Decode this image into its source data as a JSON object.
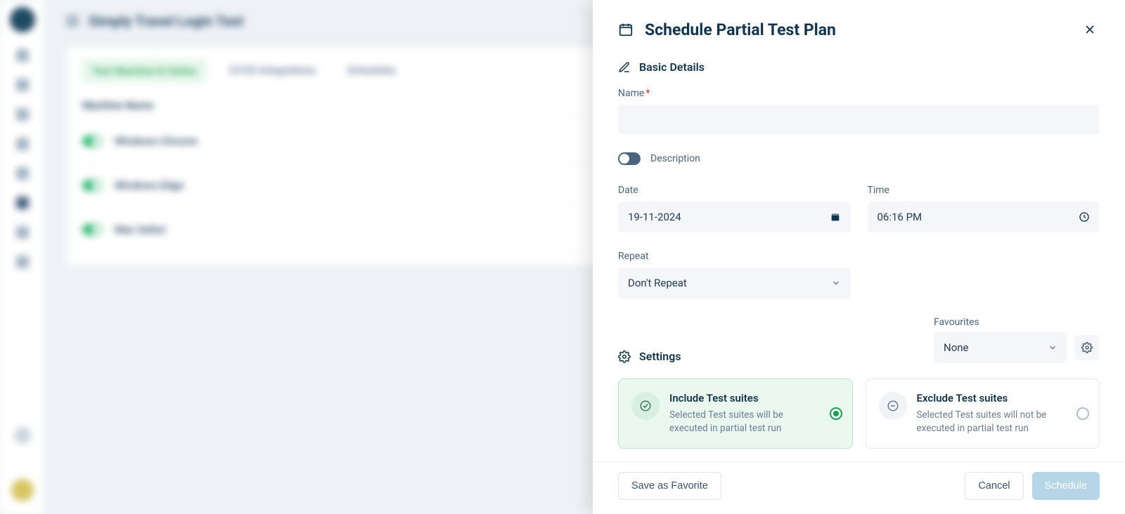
{
  "page_title": "Simply Travel Login Test",
  "tabs": {
    "machine_suites": "Test Machine & Suites",
    "cicd": "CI/CD Integrations",
    "schedules": "Schedules"
  },
  "table": {
    "column_header": "Machine Name",
    "rows": [
      "Windows Chrome",
      "Windows Edge",
      "Mac Safari"
    ]
  },
  "panel": {
    "title": "Schedule Partial Test Plan",
    "basic_details_label": "Basic Details",
    "name_label": "Name",
    "name_value": "",
    "description_label": "Description",
    "date_label": "Date",
    "date_value": "19-11-2024",
    "time_label": "Time",
    "time_value": "06:16 PM",
    "repeat_label": "Repeat",
    "repeat_value": "Don't Repeat",
    "settings_label": "Settings",
    "favourites_label": "Favourites",
    "favourites_value": "None",
    "include": {
      "title": "Include Test suites",
      "desc": "Selected Test suites will be executed in partial test run"
    },
    "exclude": {
      "title": "Exclude Test suites",
      "desc": "Selected Test suites will not be executed in partial test run"
    },
    "footer": {
      "save_favorite": "Save as Favorite",
      "cancel": "Cancel",
      "schedule": "Schedule"
    }
  }
}
